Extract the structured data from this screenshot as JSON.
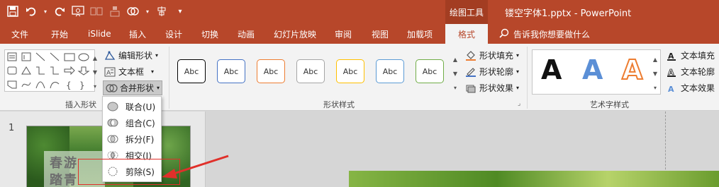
{
  "title_bar": {
    "context_tab_title": "绘图工具",
    "document_title": "镂空字体1.pptx  -  PowerPoint",
    "qat_icons": [
      "save-icon",
      "undo-icon",
      "redo-icon",
      "present-from-start-icon",
      "slide-icon",
      "shape-icon",
      "merge-icon",
      "align-icon",
      "customize-icon"
    ]
  },
  "tabs": [
    {
      "label": "文件"
    },
    {
      "label": "开始"
    },
    {
      "label": "iSlide"
    },
    {
      "label": "插入"
    },
    {
      "label": "设计"
    },
    {
      "label": "切换"
    },
    {
      "label": "动画"
    },
    {
      "label": "幻灯片放映"
    },
    {
      "label": "审阅"
    },
    {
      "label": "视图"
    },
    {
      "label": "加载项"
    },
    {
      "label": "格式"
    }
  ],
  "tell_me": "告诉我你想要做什么",
  "ribbon": {
    "insert_shapes": {
      "label": "插入形状",
      "edit_shape": "编辑形状",
      "text_box": "文本框",
      "merge_shapes": "合并形状"
    },
    "shape_styles": {
      "label": "形状样式",
      "sample_text": "Abc",
      "box_colors": [
        "#000000",
        "#4472c4",
        "#ed7d31",
        "#a5a5a5",
        "#ffc000",
        "#5b9bd5",
        "#70ad47"
      ],
      "fill": "形状填充",
      "outline": "形状轮廓",
      "effects": "形状效果"
    },
    "wordart": {
      "label": "艺术字样式",
      "letter": "A",
      "text_fill": "文本填充",
      "text_outline": "文本轮廓",
      "text_effects": "文本效果"
    }
  },
  "merge_menu": {
    "items": [
      {
        "label": "联合(U)",
        "icon": "union-icon"
      },
      {
        "label": "组合(C)",
        "icon": "combine-icon"
      },
      {
        "label": "拆分(F)",
        "icon": "fragment-icon"
      },
      {
        "label": "相交(I)",
        "icon": "intersect-icon"
      },
      {
        "label": "剪除(S)",
        "icon": "subtract-icon"
      }
    ]
  },
  "thumbnails": {
    "slide_number": "1",
    "line1": "春游",
    "line2": "踏青"
  },
  "colors": {
    "accent": "#b7472a",
    "annotation": "#e0302a"
  }
}
